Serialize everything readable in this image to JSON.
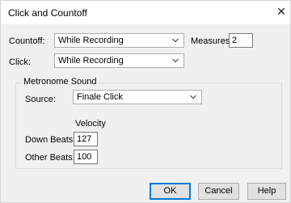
{
  "window": {
    "title": "Click and Countoff"
  },
  "countoff": {
    "label": "Countoff:",
    "value": "While Recording"
  },
  "measures": {
    "label": "Measures:",
    "value": "2"
  },
  "click": {
    "label": "Click:",
    "value": "While Recording"
  },
  "metronome": {
    "group_title": "Metronome Sound",
    "source_label": "Source:",
    "source_value": "Finale Click",
    "velocity_header": "Velocity",
    "down_beats_label": "Down Beats:",
    "down_beats_value": "127",
    "other_beats_label": "Other Beats:",
    "other_beats_value": "100"
  },
  "buttons": {
    "ok": "OK",
    "cancel": "Cancel",
    "help": "Help"
  },
  "icons": {
    "close": "close-icon",
    "dropdown": "chevron-down-icon"
  },
  "colors": {
    "dialog_bg": "#f0f0f0",
    "default_button_border": "#0078d7"
  }
}
